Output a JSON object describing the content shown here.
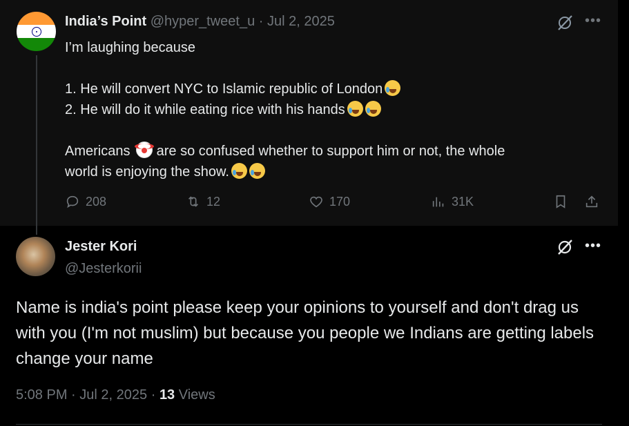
{
  "parent_tweet": {
    "author_name": "India’s Point",
    "handle": "@hyper_tweet_u",
    "separator": "·",
    "date": "Jul 2, 2025",
    "lines": [
      "I’m laughing because",
      "",
      "1. He will convert NYC to Islamic republic of London",
      "2. He will do it while eating rice with his hands",
      "",
      "Americans",
      "are so confused whether to support him or not, the whole",
      "world is enjoying the show."
    ],
    "emojis": {
      "line3": [
        "face-with-tears-of-joy"
      ],
      "line4": [
        "face-with-tears-of-joy",
        "face-with-tears-of-joy"
      ],
      "line6": [
        "clown-face"
      ],
      "line7": [
        "face-with-tears-of-joy",
        "face-with-tears-of-joy"
      ]
    },
    "stats": {
      "replies": "208",
      "reposts": "12",
      "likes": "170",
      "views": "31K"
    },
    "avatar": "india-flag",
    "icons": [
      "reply-icon",
      "repost-icon",
      "like-icon",
      "views-icon",
      "bookmark-icon",
      "share-icon",
      "grok-icon",
      "more-icon"
    ]
  },
  "reply_tweet": {
    "author_name": "Jester Kori",
    "handle": "@Jesterkorii",
    "text": "Name is india's point please keep your opinions to yourself and don't drag us with you (I'm not muslim) but because you people we Indians are getting labels change your name",
    "time": "5:08 PM",
    "separator": "·",
    "date": "Jul 2, 2025",
    "separator2": "·",
    "views_count": "13",
    "views_label": "Views",
    "avatar": "tiger-photo"
  },
  "more_glyph": "•••",
  "colors": {
    "background": "#000000",
    "parent_background": "#0f0f0f",
    "text": "#e7e9ea",
    "muted": "#71767b",
    "divider": "#2f3336"
  }
}
